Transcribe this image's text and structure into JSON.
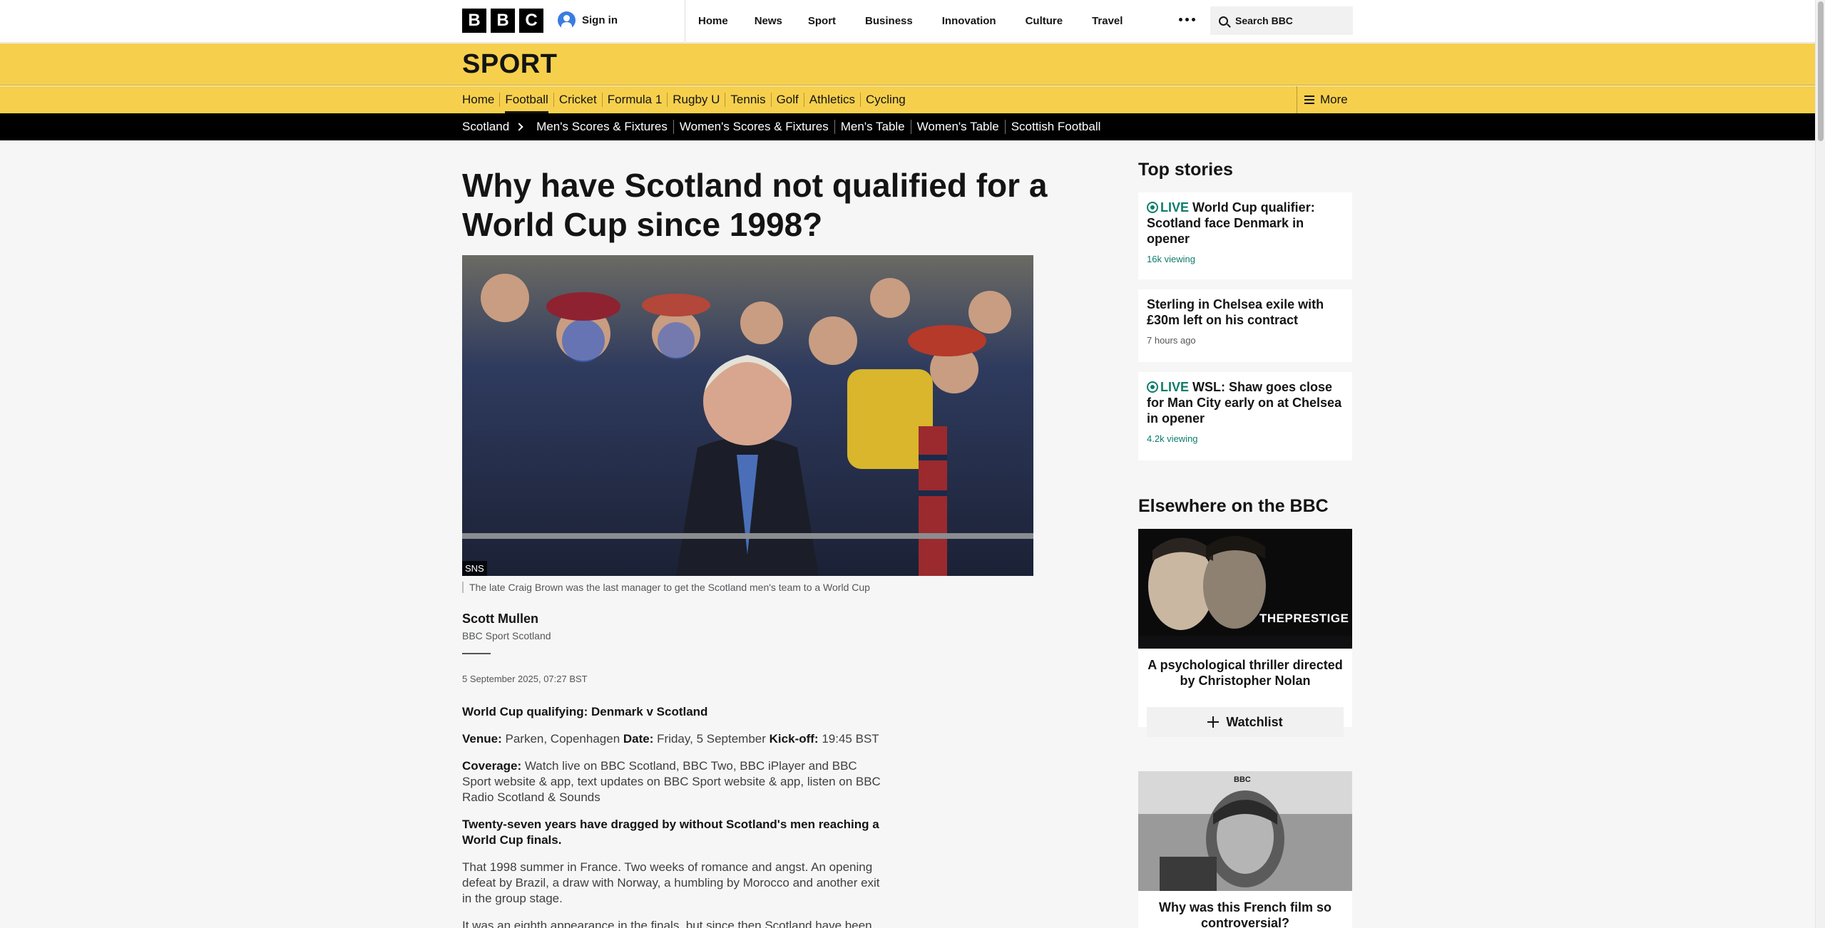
{
  "header": {
    "logo_letters": [
      "B",
      "B",
      "C"
    ],
    "signin_label": "Sign in",
    "nav": [
      "Home",
      "News",
      "Sport",
      "Business",
      "Innovation",
      "Culture",
      "Travel"
    ],
    "search_placeholder": "Search BBC"
  },
  "sport": {
    "title": "SPORT",
    "nav": [
      "Home",
      "Football",
      "Cricket",
      "Formula 1",
      "Rugby U",
      "Tennis",
      "Golf",
      "Athletics",
      "Cycling"
    ],
    "active": "Football",
    "more_label": "More"
  },
  "subnav": {
    "crumb": "Scotland",
    "links": [
      "Men's Scores & Fixtures",
      "Women's Scores & Fixtures",
      "Men's Table",
      "Women's Table",
      "Scottish Football"
    ]
  },
  "article": {
    "headline": "Why have Scotland not qualified for a World Cup since 1998?",
    "image_credit": "SNS",
    "caption": "The late Craig Brown was the last manager to get the Scotland men's team to a World Cup",
    "author": "Scott Mullen",
    "author_role": "BBC Sport Scotland",
    "date": "5 September 2025, 07:27 BST",
    "fixture_heading": "World Cup qualifying: Denmark v Scotland",
    "venue_label": "Venue:",
    "venue": "Parken, Copenhagen",
    "date_label": "Date:",
    "match_date": "Friday, 5 September",
    "kickoff_label": "Kick-off:",
    "kickoff": "19:45 BST",
    "coverage_label": "Coverage:",
    "coverage": "Watch live on BBC Scotland, BBC Two, BBC iPlayer and BBC Sport website & app, text updates on BBC Sport website & app, listen on BBC Radio Scotland & Sounds",
    "intro": "Twenty-seven years have dragged by without Scotland's men reaching a World Cup finals.",
    "para1": "That 1998 summer in France. Two weeks of romance and angst. An opening defeat by Brazil, a draw with Norway, a humbling by Morocco and another exit in the group stage.",
    "para2": "It was an eighth appearance in the finals, but since then Scotland have been"
  },
  "sidebar": {
    "top_stories_heading": "Top stories",
    "stories": [
      {
        "live": "LIVE",
        "title": "World Cup qualifier: Scotland face Denmark in opener",
        "meta": "16k viewing"
      },
      {
        "live": "",
        "title": "Sterling in Chelsea exile with £30m left on his contract",
        "meta": "7 hours ago"
      },
      {
        "live": "LIVE",
        "title": "WSL: Shaw goes close for Man City early on at Chelsea in opener",
        "meta": "4.2k viewing"
      }
    ],
    "elsewhere_heading": "Elsewhere on the BBC",
    "promo1": {
      "image_text": "THEPRESTIGE",
      "title": "A psychological thriller directed by Christopher Nolan",
      "button": "Watchlist"
    },
    "promo2": {
      "image_text": "BBC",
      "title": "Why was this French film so controversial?"
    }
  },
  "colors": {
    "sport_yellow": "#f6d04d",
    "live_green": "#0e7c6b",
    "subnav_black": "#000000"
  }
}
